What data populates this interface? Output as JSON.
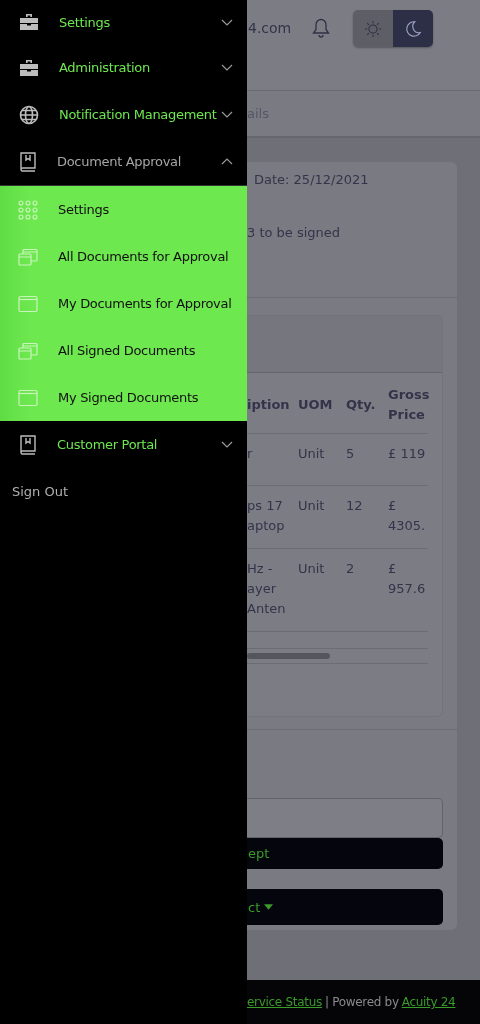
{
  "sidebar": {
    "items": [
      {
        "label": "Settings",
        "expanded": false
      },
      {
        "label": "Administration",
        "expanded": false
      },
      {
        "label": "Notification Management",
        "expanded": false
      },
      {
        "label": "Document Approval",
        "expanded": true,
        "children": [
          {
            "label": "Settings"
          },
          {
            "label": "All Documents for Approval"
          },
          {
            "label": "My Documents for Approval"
          },
          {
            "label": "All Signed Documents"
          },
          {
            "label": "My Signed Documents"
          }
        ]
      },
      {
        "label": "Customer Portal",
        "expanded": false
      }
    ],
    "sign_out": "Sign Out"
  },
  "header": {
    "site_text": "4.com",
    "theme_toggle": [
      {
        "kind": "light",
        "selected": false
      },
      {
        "kind": "dark",
        "selected": true
      }
    ]
  },
  "tab": "ails",
  "summary": {
    "date": "Date: 25/12/2021",
    "status": "3 to be signed"
  },
  "table": {
    "columns": [
      "iption",
      "UOM",
      "Qty.",
      "Gross Price"
    ],
    "rows": [
      [
        "r",
        "Unit",
        "5",
        "£ 119"
      ],
      [
        "ps 17 aptop",
        "Unit",
        "12",
        "£ 4305."
      ],
      [
        "Hz - ayer Anten",
        "Unit",
        "2",
        "£ 957.6"
      ]
    ]
  },
  "actions": {
    "accept": "ept",
    "select": "ct"
  },
  "footer": {
    "link": "ervice Status",
    "separator": "| Powered by",
    "brand": "Acuity 24"
  }
}
